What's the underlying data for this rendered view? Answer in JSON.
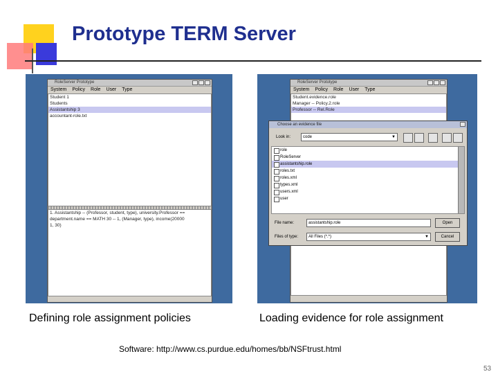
{
  "slide": {
    "title": "Prototype TERM Server",
    "page_number": "53",
    "software_line": "Software: http://www.cs.purdue.edu/homes/bb/NSFtrust.html"
  },
  "left_panel": {
    "caption": "Defining role assignment policies",
    "window_title": "RoleServer Prototype",
    "menu": [
      "System",
      "Policy",
      "Role",
      "User",
      "Type"
    ],
    "roles": [
      "Student 1",
      "Students",
      "Assistantship 3",
      "accountant-role.txt"
    ],
    "selected_role_index": 2,
    "policy_lines": [
      "1. Assistantship -- (Professor, student, type), university.Professor ==",
      "department.name == MATH 30 -- 1, (Manager, type), income(20000",
      "1, 30)"
    ]
  },
  "right_panel": {
    "caption": "Loading evidence for role assignment",
    "window_title": "RoleServer Prototype",
    "menu": [
      "System",
      "Policy",
      "Role",
      "User",
      "Type"
    ],
    "roles": [
      "Student.evidence.role",
      "Manager -- Policy.2.role",
      "Professor -- Rel.Role"
    ],
    "selected_role_index": 2,
    "dialog": {
      "title": "Choose an evidence file",
      "look_in_label": "Look in:",
      "look_in_value": "code",
      "files": [
        "role",
        "RoleServer",
        "assistantship.role",
        "roles.txt",
        "roles.xml",
        "types.xml",
        "users.xml",
        "user"
      ],
      "selected_file_index": 2,
      "file_name_label": "File name:",
      "file_name_value": "assistantship.role",
      "files_of_type_label": "Files of type:",
      "files_of_type_value": "All Files (*.*)",
      "open_label": "Open",
      "cancel_label": "Cancel"
    }
  }
}
